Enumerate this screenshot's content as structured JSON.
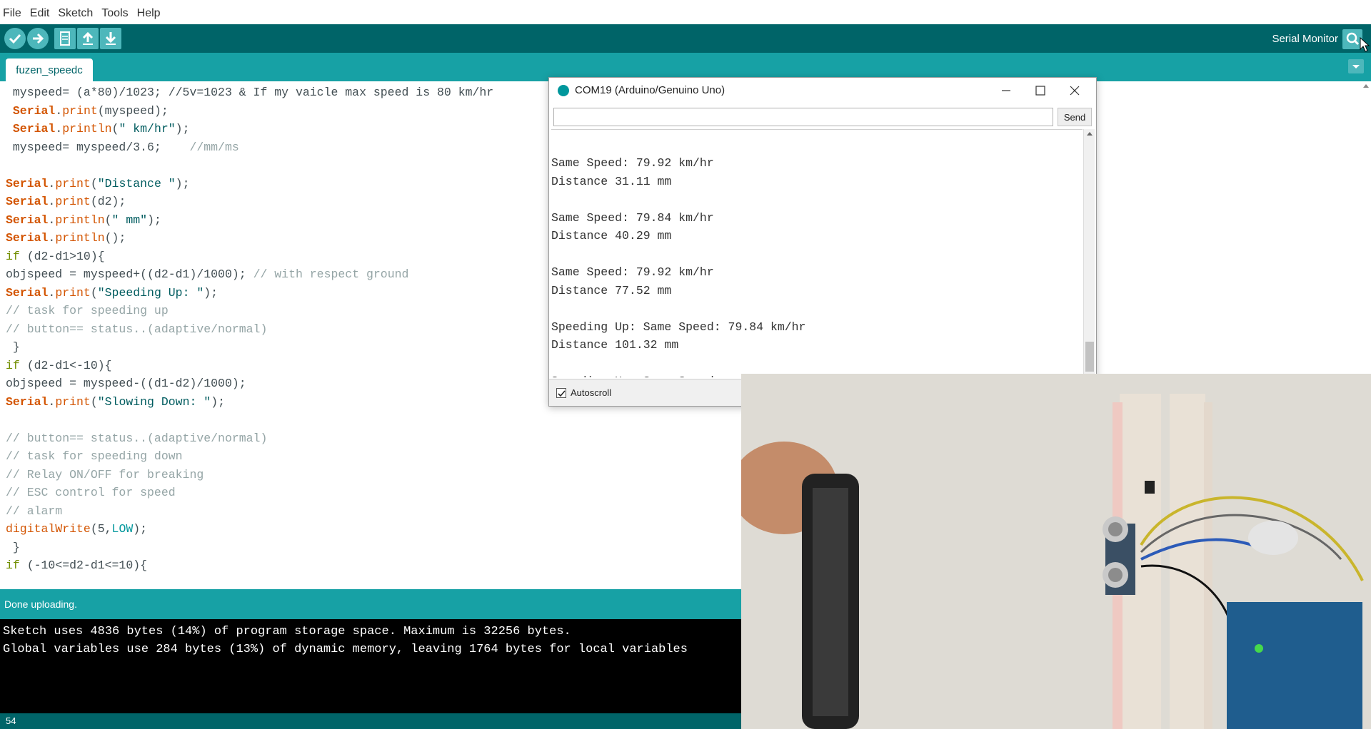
{
  "menu": [
    "File",
    "Edit",
    "Sketch",
    "Tools",
    "Help"
  ],
  "toolbar": {
    "verify_icon": "check-icon",
    "upload_icon": "arrow-right-icon",
    "new_icon": "new-file-icon",
    "open_icon": "arrow-up-icon",
    "save_icon": "arrow-down-icon",
    "serial_monitor_label": "Serial Monitor",
    "serial_monitor_icon": "magnifier-icon"
  },
  "tab": {
    "name": "fuzen_speedc"
  },
  "editor": {
    "lines": [
      [
        {
          "t": " myspeed= (a*80)/1023; //5v=1023 & If my vaicle max speed is 80 km/hr",
          "c": ""
        }
      ],
      [
        {
          "t": " ",
          "c": ""
        },
        {
          "t": "Serial",
          "c": "kw-serial"
        },
        {
          "t": ".",
          "c": ""
        },
        {
          "t": "print",
          "c": "kw-method"
        },
        {
          "t": "(myspeed);",
          "c": ""
        }
      ],
      [
        {
          "t": " ",
          "c": ""
        },
        {
          "t": "Serial",
          "c": "kw-serial"
        },
        {
          "t": ".",
          "c": ""
        },
        {
          "t": "println",
          "c": "kw-method"
        },
        {
          "t": "(",
          "c": ""
        },
        {
          "t": "\" km/hr\"",
          "c": "kw-str"
        },
        {
          "t": ");",
          "c": ""
        }
      ],
      [
        {
          "t": " myspeed= myspeed/3.6;    ",
          "c": ""
        },
        {
          "t": "//mm/ms",
          "c": "cmt"
        }
      ],
      [
        {
          "t": "",
          "c": ""
        }
      ],
      [
        {
          "t": "Serial",
          "c": "kw-serial"
        },
        {
          "t": ".",
          "c": ""
        },
        {
          "t": "print",
          "c": "kw-method"
        },
        {
          "t": "(",
          "c": ""
        },
        {
          "t": "\"Distance \"",
          "c": "kw-str"
        },
        {
          "t": ");",
          "c": ""
        }
      ],
      [
        {
          "t": "Serial",
          "c": "kw-serial"
        },
        {
          "t": ".",
          "c": ""
        },
        {
          "t": "print",
          "c": "kw-method"
        },
        {
          "t": "(d2);",
          "c": ""
        }
      ],
      [
        {
          "t": "Serial",
          "c": "kw-serial"
        },
        {
          "t": ".",
          "c": ""
        },
        {
          "t": "println",
          "c": "kw-method"
        },
        {
          "t": "(",
          "c": ""
        },
        {
          "t": "\" mm\"",
          "c": "kw-str"
        },
        {
          "t": ");",
          "c": ""
        }
      ],
      [
        {
          "t": "Serial",
          "c": "kw-serial"
        },
        {
          "t": ".",
          "c": ""
        },
        {
          "t": "println",
          "c": "kw-method"
        },
        {
          "t": "();",
          "c": ""
        }
      ],
      [
        {
          "t": "if",
          "c": "kw-if"
        },
        {
          "t": " (d2-d1>10){",
          "c": ""
        }
      ],
      [
        {
          "t": "objspeed = myspeed+((d2-d1)/1000); ",
          "c": ""
        },
        {
          "t": "// with respect ground",
          "c": "cmt"
        }
      ],
      [
        {
          "t": "Serial",
          "c": "kw-serial"
        },
        {
          "t": ".",
          "c": ""
        },
        {
          "t": "print",
          "c": "kw-method"
        },
        {
          "t": "(",
          "c": ""
        },
        {
          "t": "\"Speeding Up: \"",
          "c": "kw-str"
        },
        {
          "t": ");",
          "c": ""
        }
      ],
      [
        {
          "t": "// task for speeding up",
          "c": "cmt"
        }
      ],
      [
        {
          "t": "// button== status..(adaptive/normal)",
          "c": "cmt"
        }
      ],
      [
        {
          "t": " }",
          "c": ""
        }
      ],
      [
        {
          "t": "if",
          "c": "kw-if"
        },
        {
          "t": " (d2-d1<-10){",
          "c": ""
        }
      ],
      [
        {
          "t": "objspeed = myspeed-((d1-d2)/1000);",
          "c": ""
        }
      ],
      [
        {
          "t": "Serial",
          "c": "kw-serial"
        },
        {
          "t": ".",
          "c": ""
        },
        {
          "t": "print",
          "c": "kw-method"
        },
        {
          "t": "(",
          "c": ""
        },
        {
          "t": "\"Slowing Down: \"",
          "c": "kw-str"
        },
        {
          "t": ");",
          "c": ""
        }
      ],
      [
        {
          "t": "",
          "c": ""
        }
      ],
      [
        {
          "t": "// button== status..(adaptive/normal)",
          "c": "cmt"
        }
      ],
      [
        {
          "t": "// task for speeding down",
          "c": "cmt"
        }
      ],
      [
        {
          "t": "// Relay ON/OFF for breaking",
          "c": "cmt"
        }
      ],
      [
        {
          "t": "// ESC control for speed",
          "c": "cmt"
        }
      ],
      [
        {
          "t": "// alarm",
          "c": "cmt"
        }
      ],
      [
        {
          "t": "digitalWrite",
          "c": "kw-method"
        },
        {
          "t": "(5,",
          "c": ""
        },
        {
          "t": "LOW",
          "c": "kw-const"
        },
        {
          "t": ");",
          "c": ""
        }
      ],
      [
        {
          "t": " }",
          "c": ""
        }
      ],
      [
        {
          "t": "if",
          "c": "kw-if"
        },
        {
          "t": " (-10<=d2-d1<=10){",
          "c": ""
        }
      ]
    ]
  },
  "status": {
    "message": "Done uploading."
  },
  "console": {
    "lines": [
      "Sketch uses 4836 bytes (14%) of program storage space. Maximum is 32256 bytes.",
      "Global variables use 284 bytes (13%) of dynamic memory, leaving 1764 bytes for local variables"
    ]
  },
  "line_number": "54",
  "serial_monitor": {
    "title": "COM19 (Arduino/Genuino Uno)",
    "input_value": "",
    "send_label": "Send",
    "output": [
      "Distance 31.11 mm",
      "",
      "Same Speed: 79.92 km/hr",
      "Distance 31.11 mm",
      "",
      "Same Speed: 79.84 km/hr",
      "Distance 40.29 mm",
      "",
      "Same Speed: 79.92 km/hr",
      "Distance 77.52 mm",
      "",
      "Speeding Up: Same Speed: 79.84 km/hr",
      "Distance 101.32 mm",
      "",
      "Speeding Up: Same Speed:"
    ],
    "autoscroll_label": "Autoscroll",
    "autoscroll_checked": true
  },
  "colors": {
    "toolbar": "#006468",
    "tabbar": "#17a1a5",
    "button": "#4db7bb"
  }
}
